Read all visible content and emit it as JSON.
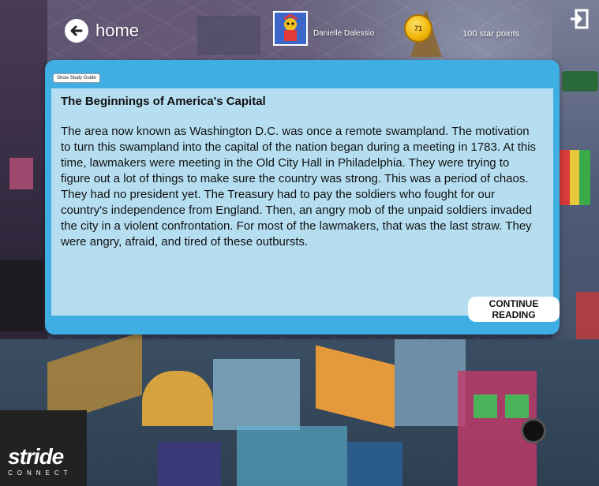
{
  "header": {
    "home_label": "home",
    "user_name": "Danielle Dalessio",
    "coin_value": "71",
    "star_points": "100 star points"
  },
  "panel": {
    "study_guide_label": "Show Study Guide",
    "title": "The Beginnings of America's Capital",
    "body": "The area now known as Washington D.C. was once a remote swampland.  The motivation to turn this swampland into the capital of the nation began during a meeting in 1783.  At this time, lawmakers were meeting in the Old City Hall in Philadelphia. They were trying to figure out a lot of things to make sure the country was strong.  This was a period of chaos.  They had no president yet.  The Treasury had to pay the soldiers who fought for our country's independence from England. Then, an angry mob of the unpaid soldiers invaded the city in a violent confrontation.  For most of the lawmakers, that was the last straw.  They were angry, afraid, and tired of these outbursts.",
    "continue_label": "CONTINUE READING"
  },
  "logo": {
    "word": "stride",
    "sub": "CONNECT"
  },
  "colors": {
    "panel_border": "#3eaee3",
    "panel_fill": "#b6def1",
    "coin": "#f2b80e"
  },
  "icons": [
    "back-arrow-icon",
    "logout-icon",
    "avatar-character"
  ]
}
